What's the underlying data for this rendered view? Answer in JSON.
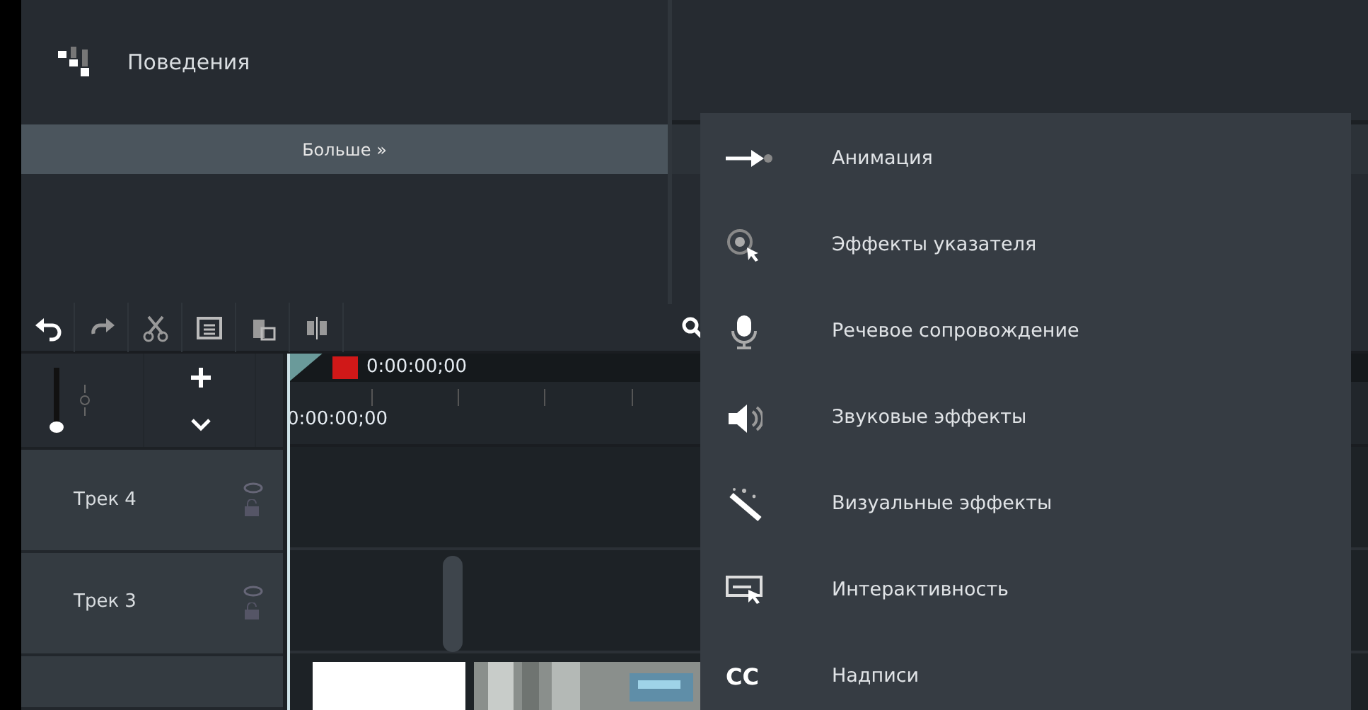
{
  "behaviors": {
    "label": "Поведения"
  },
  "more_button": {
    "label": "Больше »"
  },
  "timeline": {
    "playhead_time": "0:00:00;00",
    "ruler_start": "0:00:00;00",
    "zoom": {
      "level": 0
    },
    "tracks": [
      {
        "name": "Трек 4"
      },
      {
        "name": "Трек 3"
      }
    ]
  },
  "menu": {
    "items": [
      {
        "kind": "animation",
        "label": "Анимация"
      },
      {
        "kind": "cursor",
        "label": "Эффекты указателя"
      },
      {
        "kind": "voice",
        "label": "Речевое сопровождение"
      },
      {
        "kind": "audio",
        "label": "Звуковые эффекты"
      },
      {
        "kind": "visual",
        "label": "Визуальные эффекты"
      },
      {
        "kind": "interactive",
        "label": "Интерактивность"
      },
      {
        "kind": "captions",
        "icon_text": "CC",
        "label": "Надписи"
      }
    ]
  }
}
